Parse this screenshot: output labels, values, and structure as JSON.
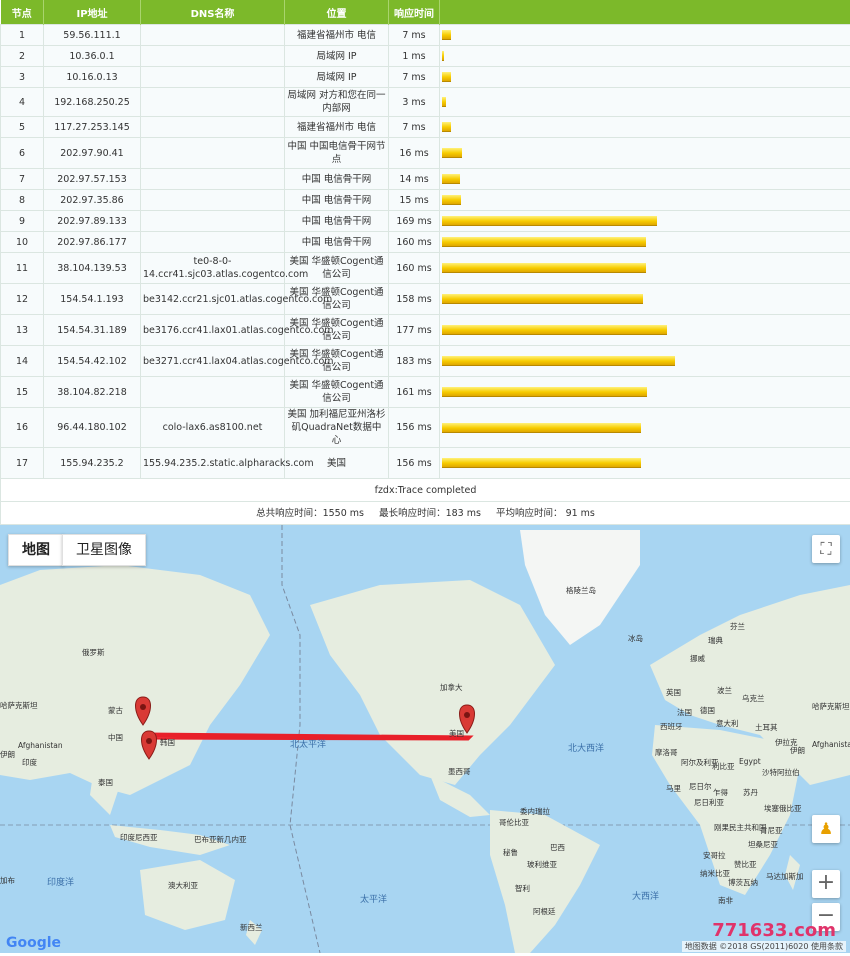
{
  "headers": [
    "节点",
    "IP地址",
    "DNS名称",
    "位置",
    "响应时间"
  ],
  "rows": [
    {
      "n": "1",
      "ip": "59.56.111.1",
      "dns": "",
      "loc": "福建省福州市 电信",
      "ms": "7 ms",
      "v": 7
    },
    {
      "n": "2",
      "ip": "10.36.0.1",
      "dns": "",
      "loc": "局域网 IP",
      "ms": "1 ms",
      "v": 1
    },
    {
      "n": "3",
      "ip": "10.16.0.13",
      "dns": "",
      "loc": "局域网 IP",
      "ms": "7 ms",
      "v": 7
    },
    {
      "n": "4",
      "ip": "192.168.250.25",
      "dns": "",
      "loc": "局域网 对方和您在同一内部网",
      "ms": "3 ms",
      "v": 3
    },
    {
      "n": "5",
      "ip": "117.27.253.145",
      "dns": "",
      "loc": "福建省福州市 电信",
      "ms": "7 ms",
      "v": 7
    },
    {
      "n": "6",
      "ip": "202.97.90.41",
      "dns": "",
      "loc": "中国 中国电信骨干网节点",
      "ms": "16 ms",
      "v": 16
    },
    {
      "n": "7",
      "ip": "202.97.57.153",
      "dns": "",
      "loc": "中国 电信骨干网",
      "ms": "14 ms",
      "v": 14
    },
    {
      "n": "8",
      "ip": "202.97.35.86",
      "dns": "",
      "loc": "中国 电信骨干网",
      "ms": "15 ms",
      "v": 15
    },
    {
      "n": "9",
      "ip": "202.97.89.133",
      "dns": "",
      "loc": "中国 电信骨干网",
      "ms": "169 ms",
      "v": 169
    },
    {
      "n": "10",
      "ip": "202.97.86.177",
      "dns": "",
      "loc": "中国 电信骨干网",
      "ms": "160 ms",
      "v": 160
    },
    {
      "n": "11",
      "ip": "38.104.139.53",
      "dns": "te0-8-0-14.ccr41.sjc03.atlas.cogentco.com",
      "loc": "美国 华盛顿Cogent通信公司",
      "ms": "160 ms",
      "v": 160
    },
    {
      "n": "12",
      "ip": "154.54.1.193",
      "dns": "be3142.ccr21.sjc01.atlas.cogentco.com",
      "loc": "美国 华盛顿Cogent通信公司",
      "ms": "158 ms",
      "v": 158
    },
    {
      "n": "13",
      "ip": "154.54.31.189",
      "dns": "be3176.ccr41.lax01.atlas.cogentco.com",
      "loc": "美国 华盛顿Cogent通信公司",
      "ms": "177 ms",
      "v": 177
    },
    {
      "n": "14",
      "ip": "154.54.42.102",
      "dns": "be3271.ccr41.lax04.atlas.cogentco.com",
      "loc": "美国 华盛顿Cogent通信公司",
      "ms": "183 ms",
      "v": 183
    },
    {
      "n": "15",
      "ip": "38.104.82.218",
      "dns": "",
      "loc": "美国 华盛顿Cogent通信公司",
      "ms": "161 ms",
      "v": 161
    },
    {
      "n": "16",
      "ip": "96.44.180.102",
      "dns": "colo-lax6.as8100.net",
      "loc": "美国 加利福尼亚州洛杉矶QuadraNet数据中心",
      "ms": "156 ms",
      "v": 156
    },
    {
      "n": "17",
      "ip": "155.94.235.2",
      "dns": "155.94.235.2.static.alpharacks.com",
      "loc": "美国",
      "ms": "156 ms",
      "v": 156
    }
  ],
  "trace_status": "fzdx:Trace completed",
  "summary": "总共响应时间：1550 ms     最长响应时间：183 ms     平均响应时间： 91 ms",
  "map": {
    "tab_map": "地图",
    "tab_satellite": "卫星图像",
    "zoom_in": "+",
    "zoom_out": "−",
    "google": "Google",
    "attribution": "地图数据 ©2018 GS(2011)6020   使用条款",
    "watermark": "771633.com",
    "labels": {
      "greenland": "格陵兰岛",
      "iceland": "冰岛",
      "finland": "芬兰",
      "sweden": "瑞典",
      "norway": "挪威",
      "russia": "俄罗斯",
      "kazakhstan": "哈萨克斯坦",
      "mongolia": "蒙古",
      "china": "中国",
      "korea": "韩国",
      "thailand": "泰国",
      "afghanistan": "Afghanistan",
      "iran": "伊朗",
      "saudi": "沙特阿拉伯",
      "india": "印度",
      "indonesia": "印度尼西亚",
      "png": "巴布亚新几内亚",
      "australia": "澳大利亚",
      "nz": "新西兰",
      "canada": "加拿大",
      "usa": "美国",
      "mexico": "墨西哥",
      "venezuela": "委内瑞拉",
      "colombia": "哥伦比亚",
      "peru": "秘鲁",
      "brazil": "巴西",
      "bolivia": "玻利维亚",
      "chile": "智利",
      "argentina": "阿根廷",
      "uk": "英国",
      "france": "法国",
      "spain": "西班牙",
      "poland": "波兰",
      "ukraine": "乌克兰",
      "turkey": "土耳其",
      "algeria": "阿尔及利亚",
      "libya": "利比亚",
      "egypt": "Egypt",
      "mali": "马里",
      "niger": "尼日尔",
      "chad": "乍得",
      "sudan": "苏丹",
      "nigeria": "尼日利亚",
      "ethiopia": "埃塞俄比亚",
      "drc": "刚果民主共和国",
      "kenya": "肯尼亚",
      "tanzania": "坦桑尼亚",
      "angola": "安哥拉",
      "namibia": "纳米比亚",
      "southafrica": "南非",
      "madagascar": "马达加斯加",
      "germany": "德国",
      "italy": "意大利",
      "kazakhstan2": "哈萨克斯坦",
      "afghanistan2": "Afghanistan",
      "iran2": "伊朗",
      "iraq": "伊拉克",
      "morocco": "摩洛哥",
      "zambia": "赞比亚",
      "botswana": "博茨瓦纳",
      "rosa": "加布"
    },
    "oceans": {
      "npacific": "北太平洋",
      "natlantic": "北大西洋",
      "spacific": "太平洋",
      "satlantic": "大西洋",
      "indian": "印度洋"
    }
  }
}
